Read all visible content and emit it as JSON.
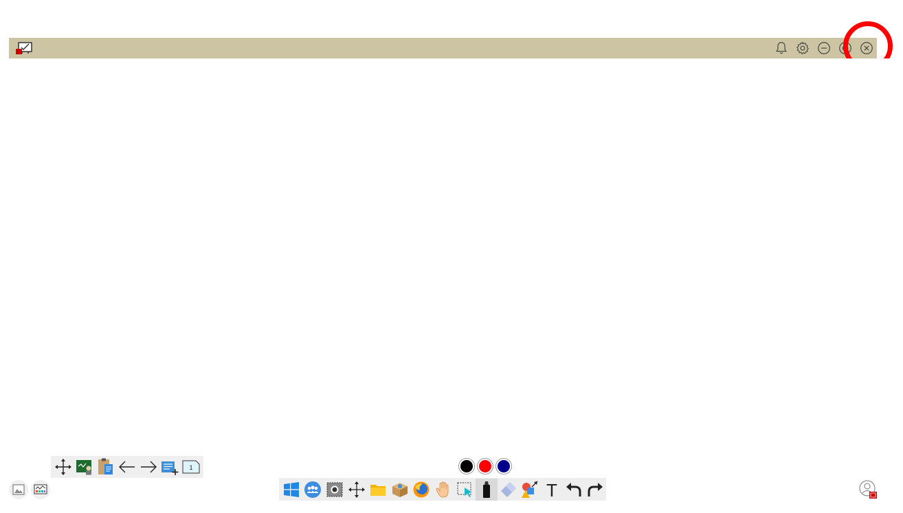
{
  "titlebar": {
    "background": "#cdc4a3",
    "logo_icon": "whiteboard-app-icon",
    "buttons": [
      "bell-icon",
      "gear-icon",
      "minimize-icon",
      "maximize-icon",
      "close-icon"
    ]
  },
  "highlight": {
    "color": "#ff0000",
    "target": "close-button"
  },
  "page_toolbar": {
    "icons": [
      "move-icon",
      "teacher-board-icon",
      "clipboard-icon",
      "previous-page-icon",
      "next-page-icon",
      "add-page-icon",
      "page-number-icon"
    ],
    "page_number": "1"
  },
  "corner_buttons": [
    "image-icon",
    "gallery-icon"
  ],
  "pen_colors": [
    "#000000",
    "#ff0000",
    "#00008b"
  ],
  "main_toolbar": {
    "icons": [
      "windows-icon",
      "users-icon",
      "screenshot-icon",
      "move-icon",
      "folder-icon",
      "package-icon",
      "browser-icon",
      "hand-icon",
      "select-icon",
      "marker-icon",
      "eraser-icon",
      "shapes-icon",
      "text-icon",
      "undo-icon",
      "redo-icon"
    ],
    "active": "marker-icon",
    "text_tool_glyph": "T"
  },
  "user": {
    "icon": "user-avatar-icon"
  }
}
